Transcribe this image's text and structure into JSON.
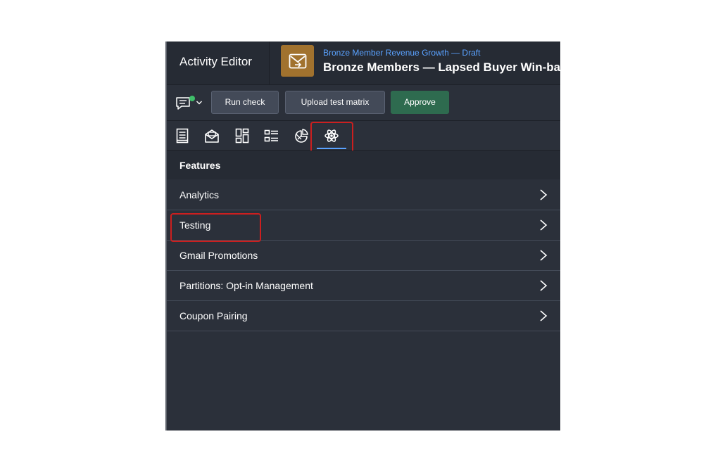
{
  "header": {
    "editor_title": "Activity Editor",
    "activity_icon": "email-send-icon",
    "subtitle": "Bronze Member Revenue Growth — Draft",
    "title": "Bronze Members — Lapsed Buyer Win-back",
    "icon_color": "#a1722e",
    "subtitle_color": "#5aa2ff"
  },
  "toolbar": {
    "comment_icon": "comment-icon",
    "run_check_label": "Run check",
    "upload_label": "Upload test matrix",
    "approve_label": "Approve",
    "approve_color": "#2e6b4f"
  },
  "tabs": [
    {
      "icon": "document-icon",
      "active": false
    },
    {
      "icon": "envelope-open-icon",
      "active": false
    },
    {
      "icon": "layout-grid-icon",
      "active": false
    },
    {
      "icon": "checklist-icon",
      "active": false
    },
    {
      "icon": "segment-pie-icon",
      "active": false
    },
    {
      "icon": "atom-icon",
      "active": true
    }
  ],
  "features": {
    "title": "Features",
    "items": [
      {
        "label": "Analytics"
      },
      {
        "label": "Testing"
      },
      {
        "label": "Gmail Promotions"
      },
      {
        "label": "Partitions: Opt-in Management"
      },
      {
        "label": "Coupon Pairing"
      }
    ]
  },
  "highlight_color": "#cc1f1f"
}
